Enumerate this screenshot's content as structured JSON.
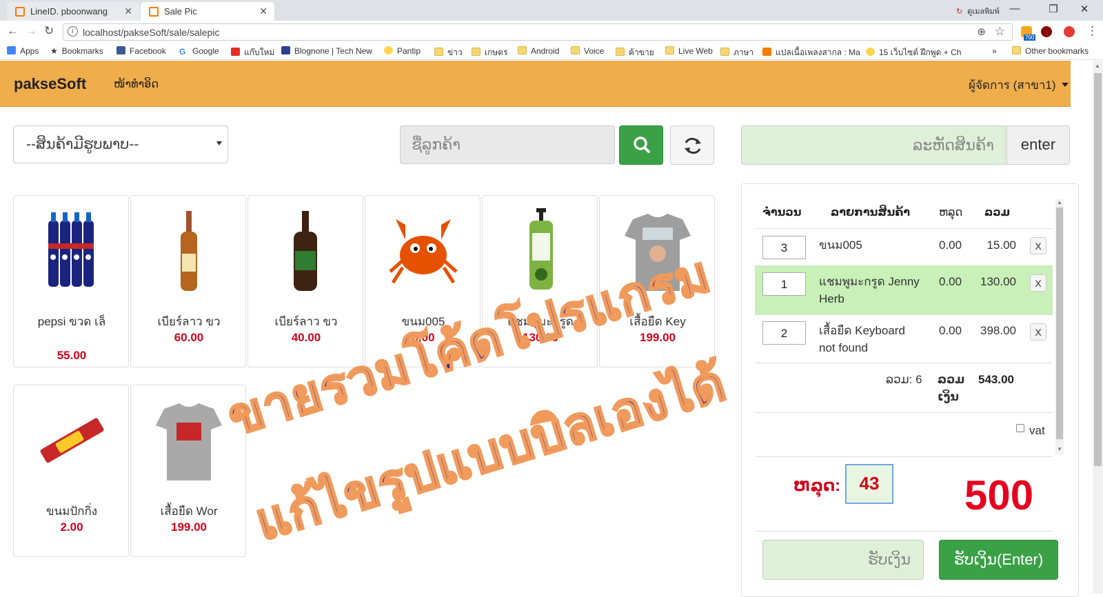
{
  "browser": {
    "tabs": [
      {
        "title": "LineID. pboonwang"
      },
      {
        "title": "Sale Pic"
      }
    ],
    "user_name": "ดูเมลพิมพ์",
    "url": "localhost/pakseSoft/sale/salepic",
    "extension_badge": "700",
    "bookmarks": [
      {
        "label": "Apps"
      },
      {
        "label": "Bookmarks"
      },
      {
        "label": "Facebook"
      },
      {
        "label": "Google"
      },
      {
        "label": "แก๊บใหม่"
      },
      {
        "label": "Blognone | Tech New"
      },
      {
        "label": "Pantip"
      },
      {
        "label": "ข่าว"
      },
      {
        "label": "เกษตร"
      },
      {
        "label": "Android"
      },
      {
        "label": "Voice"
      },
      {
        "label": "ค้าขาย"
      },
      {
        "label": "Live Web"
      },
      {
        "label": "ภาษา"
      },
      {
        "label": "แปลเนื้อเพลงสากล : Ma"
      },
      {
        "label": "15 เว็บไซต์ ฝึกพูด + Ch"
      }
    ],
    "other_bookmarks": "Other bookmarks",
    "more_chevron": "»"
  },
  "app": {
    "brand": "pakseSoft",
    "nav_home": "ໜ້າທຳອິດ",
    "user_menu": "ผู้จัดการ (สาขา1)"
  },
  "controls": {
    "category_select": "--ສິນຄ້າມີຮູບພາບ--",
    "customer_placeholder": "ຊື່ລູກຄ້າ",
    "product_code_placeholder": "ລະຫັດສິນຄ້າ",
    "enter_button": "enter"
  },
  "products": [
    {
      "name": "pepsi ขวด เล็",
      "price": "55.00"
    },
    {
      "name": "เบียร์ลาว ขว",
      "price": "60.00"
    },
    {
      "name": "เบียร์ลาว ขว",
      "price": "40.00"
    },
    {
      "name": "ขนม005",
      "price": "5.00"
    },
    {
      "name": "แชมพูมะกรูด",
      "price": "130.00"
    },
    {
      "name": "เสื้อยืด Key",
      "price": "199.00"
    },
    {
      "name": "ขนมปักกิ่ง",
      "price": "2.00"
    },
    {
      "name": "เสื้อยืด Wor",
      "price": "199.00"
    }
  ],
  "cart": {
    "headers": {
      "qty": "ຈຳນວນ",
      "item": "ລາຍການສິນຄ້າ",
      "discount": "ຫລຸດ",
      "total": "ລວມ"
    },
    "rows": [
      {
        "qty": "3",
        "name": "ขนม005",
        "discount": "0.00",
        "total": "15.00",
        "remove": "X"
      },
      {
        "qty": "1",
        "name": "แชมพูมะกรูด Jenny Herb",
        "discount": "0.00",
        "total": "130.00",
        "remove": "X"
      },
      {
        "qty": "2",
        "name": "เสื้อยืด Keyboard not found",
        "discount": "0.00",
        "total": "398.00",
        "remove": "X"
      }
    ],
    "summary_count": "ລວມ: 6",
    "summary_money_label": "ລວມ ເງິນ",
    "summary_amount": "543.00",
    "vat_label": "vat",
    "discount_label": "ຫລຸດ:",
    "discount_value": "43",
    "grand_total": "500",
    "pay_placeholder": "ຮັບເງິນ",
    "pay_button": "ຮັບເງິນ(Enter)"
  },
  "overlay": {
    "line1": "ขายรวมโค้ดโปรแกรม",
    "line2": "แก้ไขรูปแบบบิลเองได้"
  },
  "colors": {
    "navbar": "#efad4c",
    "success": "#3aa147",
    "price_red": "#d0021b",
    "highlight_row": "#c8f0b8",
    "overlay_text": "#3a2f8f",
    "overlay_stroke": "#f09a5c"
  }
}
